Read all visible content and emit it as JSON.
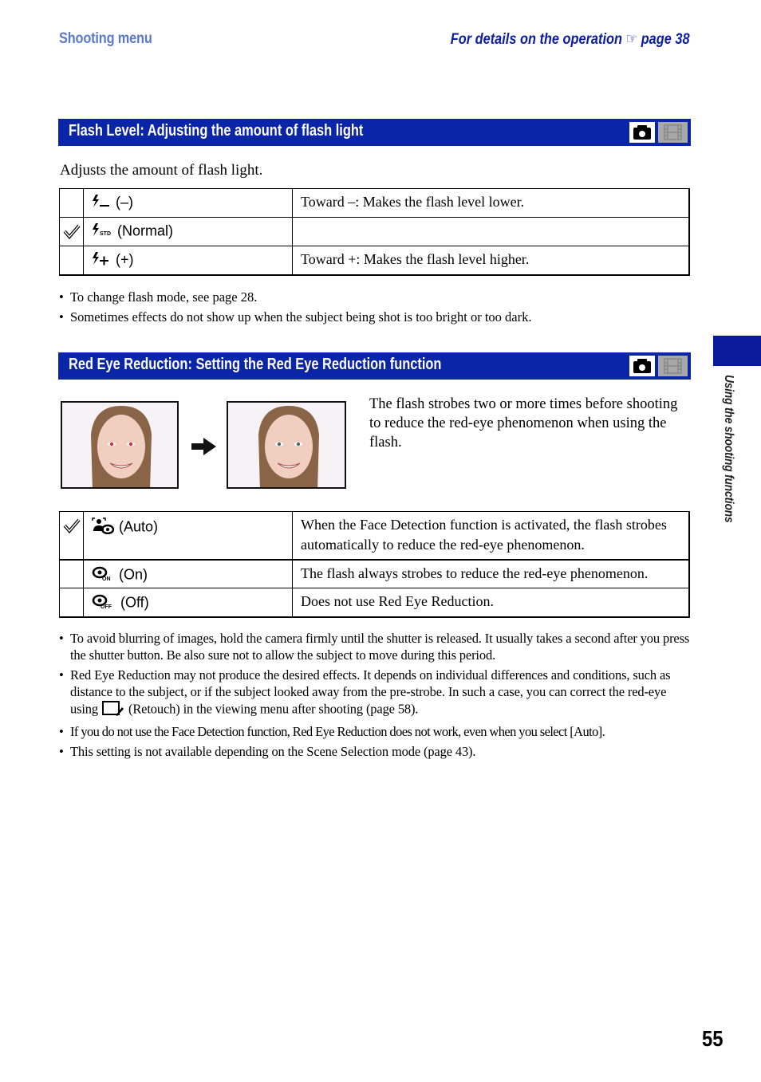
{
  "header": {
    "section": "Shooting menu",
    "details_prefix": "For details on the operation",
    "details_icon": "pointing-hand-icon",
    "details_page": "page 38"
  },
  "flash_level": {
    "title": "Flash Level: Adjusting the amount of flash light",
    "mode_icons": [
      "camera-icon",
      "movie-icon"
    ],
    "intro": "Adjusts the amount of flash light.",
    "rows": [
      {
        "selected": false,
        "icon": "flash-minus-icon",
        "label": "(–)",
        "description": "Toward –: Makes the flash level lower."
      },
      {
        "selected": true,
        "icon": "flash-std-icon",
        "label": "(Normal)",
        "description": ""
      },
      {
        "selected": false,
        "icon": "flash-plus-icon",
        "label": "(+)",
        "description": "Toward +: Makes the flash level higher."
      }
    ],
    "notes": [
      "To change flash mode, see page 28.",
      "Sometimes effects do not show up when the subject being shot is too bright or too dark."
    ]
  },
  "red_eye": {
    "title": "Red Eye Reduction: Setting the Red Eye Reduction function",
    "mode_icons": [
      "camera-icon",
      "movie-icon"
    ],
    "images": [
      "before-red-eye-photo",
      "after-red-eye-photo"
    ],
    "intro": "The flash strobes two or more times before shooting to reduce the red-eye phenomenon when using the flash.",
    "rows": [
      {
        "selected": true,
        "icon": "face-redeye-auto-icon",
        "label": "(Auto)",
        "description": "When the Face Detection function is activated, the flash strobes automatically to reduce the red-eye phenomenon."
      },
      {
        "selected": false,
        "icon": "redeye-on-icon",
        "label": "(On)",
        "description": "The flash always strobes to reduce the red-eye phenomenon."
      },
      {
        "selected": false,
        "icon": "redeye-off-icon",
        "label": "(Off)",
        "description": "Does not use Red Eye Reduction."
      }
    ],
    "notes": [
      "To avoid blurring of images, hold the camera firmly until the shutter is released. It usually takes a second after you press the shutter button. Be also sure not to allow the subject to move during this period.",
      "Red Eye Reduction may not produce the desired effects. It depends on individual differences and conditions, such as distance to the subject, or if the subject looked away from the pre-strobe. In such a case, you can correct the red-eye using",
      "(Retouch) in the viewing menu after shooting (page 58).",
      "If you do not use the Face Detection function, Red Eye Reduction does not work, even when you select [Auto].",
      "This setting is not available depending on the Scene Selection mode (page 43)."
    ]
  },
  "side_tab": "Using the shooting functions",
  "page_number": "55",
  "colors": {
    "section_bar": "#0a25a8",
    "header_section": "#5a78cf",
    "header_details": "#0b1ea0",
    "side_tab": "#0a1a9a"
  }
}
